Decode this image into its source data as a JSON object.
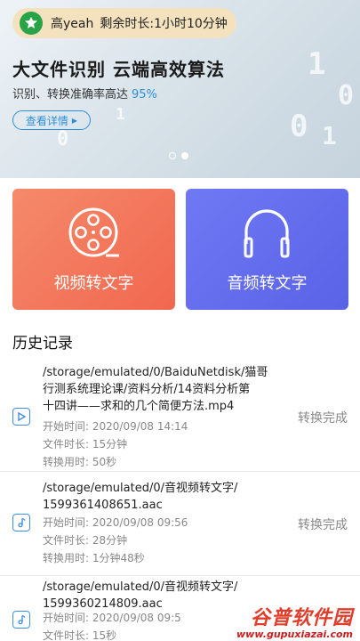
{
  "user": {
    "name": "高yeah",
    "remaining": "剩余时长:1小时10分钟"
  },
  "banner": {
    "title": "大文件识别 云端高效算法",
    "subtitle": "识别、转换准确率高达",
    "accuracy": "95%",
    "detail_button": "查看详情",
    "slide_count": 2,
    "active_slide": 2
  },
  "features": [
    {
      "label": "视频转文字",
      "icon": "film-reel-icon",
      "color": "#f1674f"
    },
    {
      "label": "音频转文字",
      "icon": "headphones-icon",
      "color": "#5a62e6"
    }
  ],
  "history": {
    "title": "历史记录",
    "items": [
      {
        "type": "video",
        "path_lines": [
          "/storage/emulated/0/BaiduNetdisk/猫哥",
          "行测系统理论课/资料分析/14资料分析第",
          "十四讲——求和的几个简便方法.mp4"
        ],
        "start_time": "开始时间:   2020/09/08 14:14",
        "duration": "文件时长:   15分钟",
        "convert_time": "转换用时:   50秒",
        "status": "转换完成"
      },
      {
        "type": "audio",
        "path_lines": [
          "/storage/emulated/0/音视频转文字/",
          "1599361408651.aac"
        ],
        "start_time": "开始时间:   2020/09/08 09:56",
        "duration": "文件时长:   28分钟",
        "convert_time": "转换用时:   1分钟48秒",
        "status": "转换完成"
      },
      {
        "type": "audio",
        "path_lines": [
          "/storage/emulated/0/音视频转文字/",
          "1599360214809.aac"
        ],
        "start_time": "开始时间:   2020/09/08 09:5",
        "duration": "文件时长:   15秒"
      }
    ]
  },
  "watermark": {
    "name": "谷普软件园",
    "url": "www.gupuxiazai.com"
  },
  "colors": {
    "accent": "#2e8fd8",
    "video_card": "#f1674f",
    "audio_card": "#5a62e6",
    "pill": "#f3e2bd"
  }
}
